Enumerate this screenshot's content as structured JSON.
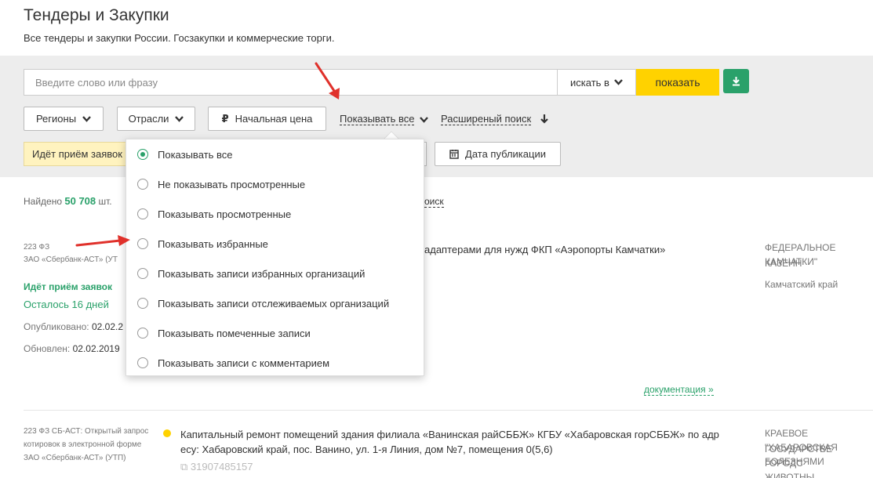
{
  "header": {
    "title": "Тендеры и Закупки",
    "subtitle": "Все тендеры и закупки России. Госзакупки и коммерческие торги."
  },
  "search": {
    "placeholder": "Введите слово или фразу",
    "search_in_label": "искать в",
    "show_label": "показать",
    "download_icon": "download-icon"
  },
  "filters": {
    "regions": "Регионы",
    "industries": "Отрасли",
    "start_price": "Начальная цена",
    "show_all": "Показывать все",
    "advanced_search": "Расширеный поиск",
    "status_chip": "Идёт приём заявок",
    "publication_date": "Дата публикации"
  },
  "results_summary": {
    "found_prefix": "Найдено",
    "found_count": "50 708",
    "found_suffix": "шт.",
    "search_link": "оиск"
  },
  "dropdown": {
    "options": [
      {
        "label": "Показывать все",
        "selected": true
      },
      {
        "label": "Не показывать просмотренные",
        "selected": false
      },
      {
        "label": "Показывать просмотренные",
        "selected": false
      },
      {
        "label": "Показывать избранные",
        "selected": false
      },
      {
        "label": "Показывать записи избранных организаций",
        "selected": false
      },
      {
        "label": "Показывать записи отслеживаемых организаций",
        "selected": false
      },
      {
        "label": "Показывать помеченные записи",
        "selected": false
      },
      {
        "label": "Показывать записи с комментарием",
        "selected": false
      }
    ]
  },
  "results": [
    {
      "law": "223 ФЗ",
      "platform": "ЗАО «Сбербанк-АСТ» (УТ",
      "status": "Идёт приём заявок",
      "remaining": "Осталось 16 дней",
      "published_label": "Опубликовано:",
      "published": "02.02.2",
      "updated_label": "Обновлен:",
      "updated": "02.02.2019",
      "title": "адаптерами для нужд ФКП «Аэропорты Камчатки»",
      "org_line1": "ФЕДЕРАЛЬНОЕ КАЗЕНН",
      "org_line2": "КАМЧАТКИ\"",
      "region": "Камчатский край",
      "docs": "документация"
    },
    {
      "law_line1": "223 ФЗ СБ-АСТ: Открытый запрос",
      "law_line2": "котировок в электронной форме",
      "platform": "ЗАО «Сбербанк-АСТ» (УТП)",
      "title_line1": "Капитальный ремонт помещений здания филиала «Ванинская райСББЖ» КГБУ «Хабаровская горСББЖ» по адр",
      "title_line2": "есу: Хабаровский край, пос. Ванино, ул. 1-я Линия, дом №7, помещения 0(5,6)",
      "reg_number": "31907485157",
      "org_line1": "КРАЕВОЕ ГОСУДАРСТВЕ",
      "org_line2": "\"ХАБАРОВСКАЯ ГОРОДС",
      "org_line3": "БОЛЕЗНЯМИ ЖИВОТНЫ"
    }
  ],
  "colors": {
    "accent_green": "#2aa16a",
    "accent_yellow": "#ffd200",
    "panel_gray": "#ededed",
    "annotation_red": "#e0312b"
  }
}
